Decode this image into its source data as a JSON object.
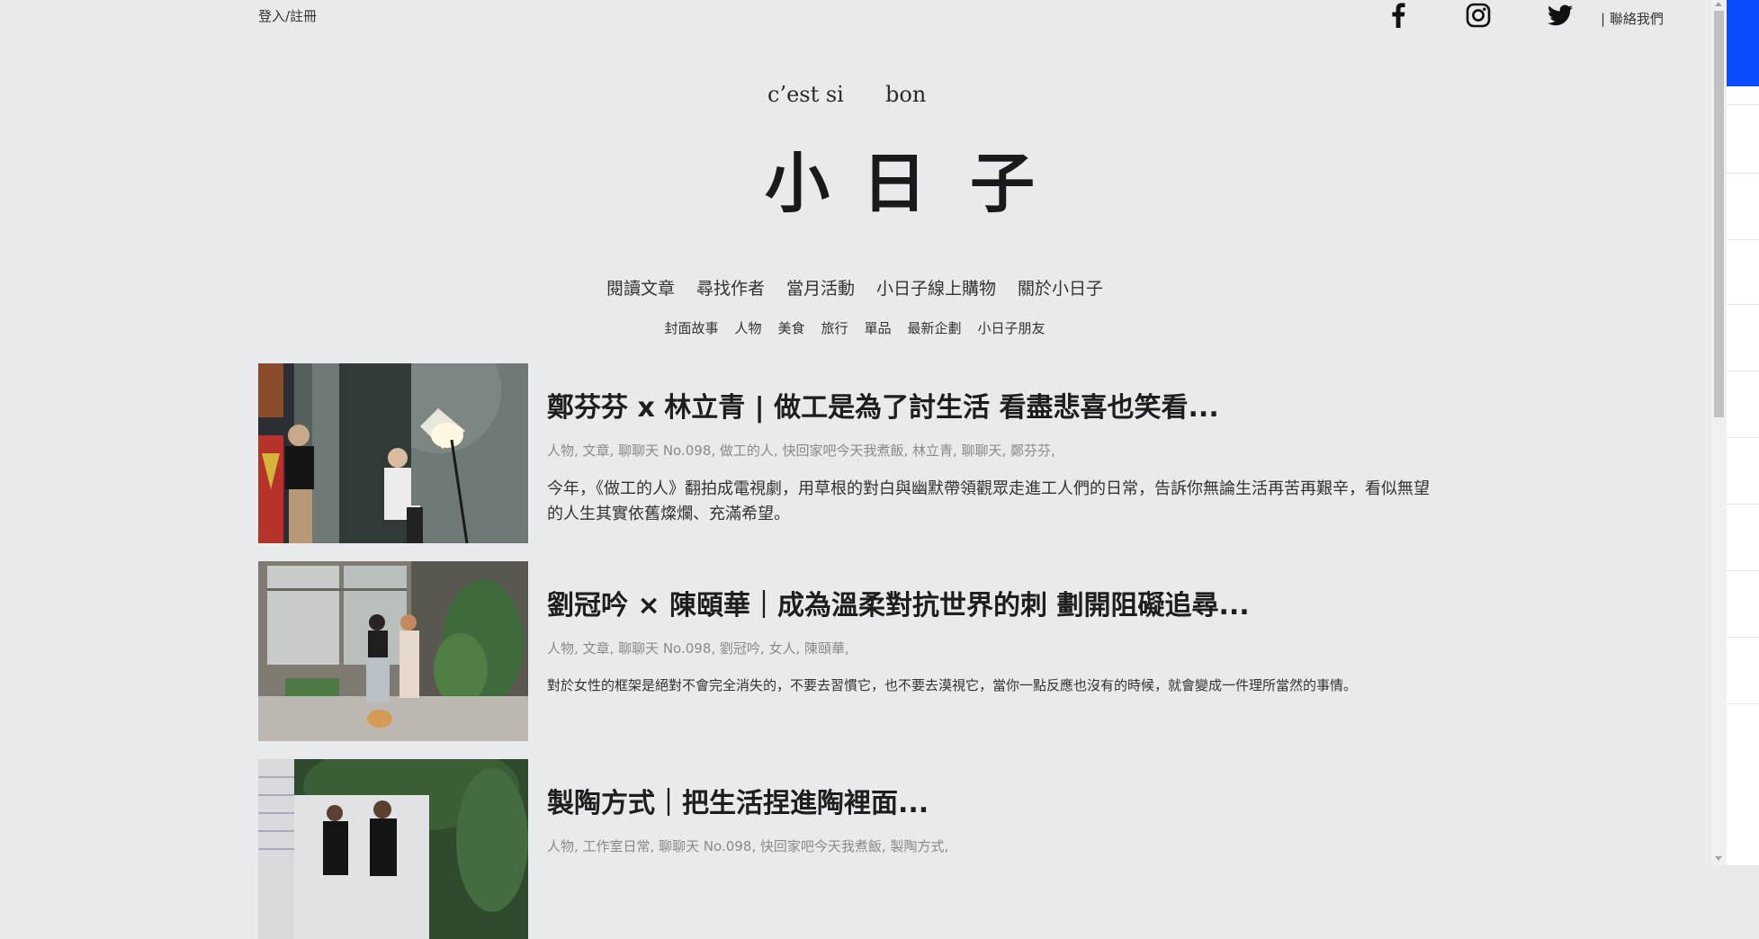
{
  "topbar": {
    "login_label": "登入/註冊",
    "contact_label": "| 聯絡我們",
    "social": [
      {
        "name": "facebook-icon"
      },
      {
        "name": "instagram-icon"
      },
      {
        "name": "twitter-icon"
      }
    ]
  },
  "logo": {
    "tagline_left": "c’est si",
    "tagline_right": "bon",
    "char1": "小",
    "char2": "日",
    "char3": "子"
  },
  "main_nav": {
    "items": [
      "閱讀文章",
      "尋找作者",
      "當月活動",
      "小日子線上購物",
      "關於小日子"
    ]
  },
  "sub_nav": {
    "items": [
      "封面故事",
      "人物",
      "美食",
      "旅行",
      "單品",
      "最新企劃",
      "小日子朋友"
    ]
  },
  "articles": [
    {
      "title": "鄭芬芬 x 林立青 | 做工是為了討生活 看盡悲喜也笑看...",
      "tags": "人物, 文章, 聊聊天 No.098, 做工的人, 快回家吧今天我煮飯, 林立青, 聊聊天, 鄭芬芬,",
      "excerpt": "今年，《做工的人》翻拍成電視劇，用草根的對白與幽默帶領觀眾走進工人們的日常，告訴你無論生活再苦再艱辛，看似無望的人生其實依舊燦爛、充滿希望。"
    },
    {
      "title": "劉冠吟 × 陳頤華｜成為溫柔對抗世界的刺 劃開阻礙追尋...",
      "tags": "人物, 文章, 聊聊天 No.098, 劉冠吟, 女人, 陳頤華,",
      "excerpt": "對於女性的框架是絕對不會完全消失的，不要去習慣它，也不要去漠視它，當你一點反應也沒有的時候，就會變成一件理所當然的事情。"
    },
    {
      "title": "製陶方式｜把生活捏進陶裡面...",
      "tags": "人物, 工作室日常, 聊聊天 No.098, 快回家吧今天我煮飯, 製陶方式,"
    }
  ],
  "colors": {
    "background": "#e9eaee",
    "side_panel_accent": "#0a4bff"
  }
}
